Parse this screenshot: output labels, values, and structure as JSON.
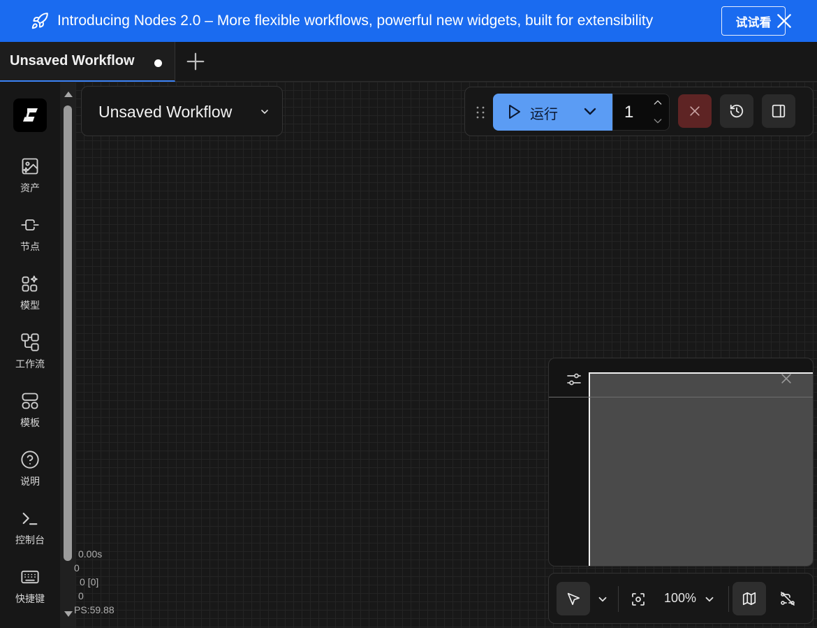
{
  "banner": {
    "text": "Introducing Nodes 2.0 – More flexible workflows, powerful new widgets, built for extensibility",
    "try_label": "试试看",
    "color": "#1a6bf0"
  },
  "tabs": [
    {
      "label": "Unsaved Workflow",
      "unsaved": true
    }
  ],
  "sidebar": {
    "logo_icon": "comfy-logo-icon",
    "items": [
      {
        "label": "资产",
        "icon": "image-assets-icon"
      },
      {
        "label": "节点",
        "icon": "node-icon"
      },
      {
        "label": "模型",
        "icon": "models-sparkle-icon"
      },
      {
        "label": "工作流",
        "icon": "workflow-icon"
      },
      {
        "label": "模板",
        "icon": "templates-icon"
      },
      {
        "label": "说明",
        "icon": "help-icon"
      },
      {
        "label": "控制台",
        "icon": "terminal-icon"
      },
      {
        "label": "快捷键",
        "icon": "keyboard-icon"
      }
    ]
  },
  "workflow": {
    "name": "Unsaved Workflow"
  },
  "runbar": {
    "run_label": "运行",
    "batch_count": "1",
    "accent": "#5b9cf4",
    "stop_color": "#5e2424"
  },
  "stats": [
    "0.00s",
    "0",
    "0 [0]",
    "0",
    "PS:59.88"
  ],
  "bottombar": {
    "zoom": "100%"
  }
}
